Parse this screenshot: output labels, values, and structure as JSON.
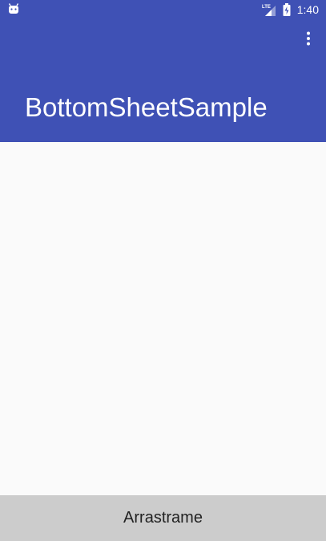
{
  "status_bar": {
    "time": "1:40",
    "network_label": "LTE",
    "icons": [
      "android-notification-icon",
      "signal-icon",
      "battery-icon"
    ]
  },
  "app_bar": {
    "title": "BottomSheetSample",
    "overflow_icon": "more-vert-icon",
    "color": "#3f51b5"
  },
  "bottom_sheet": {
    "label": "Arrastrame",
    "color": "#cccccc"
  },
  "colors": {
    "primary": "#3f51b5",
    "background": "#fafafa",
    "sheet": "#cccccc"
  }
}
